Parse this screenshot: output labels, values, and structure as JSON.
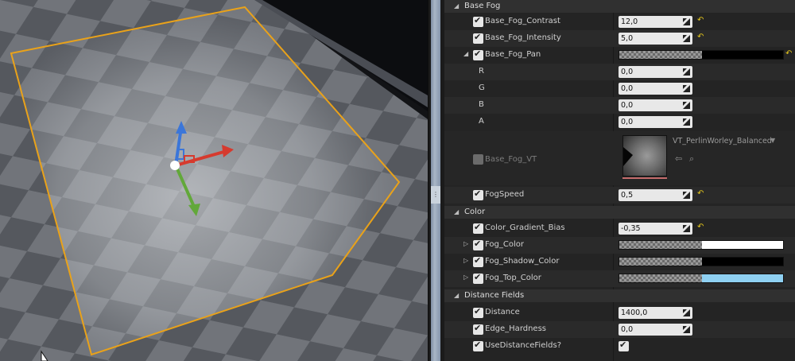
{
  "panel": {
    "categories": [
      {
        "label": "Base Fog"
      },
      {
        "label": "Color"
      },
      {
        "label": "Distance Fields"
      }
    ],
    "base_fog": {
      "contrast": {
        "label": "Base_Fog_Contrast",
        "value": "12,0"
      },
      "intensity": {
        "label": "Base_Fog_Intensity",
        "value": "5,0"
      },
      "pan": {
        "label": "Base_Fog_Pan",
        "color": "#000000",
        "r": {
          "label": "R",
          "value": "0,0"
        },
        "g": {
          "label": "G",
          "value": "0,0"
        },
        "b": {
          "label": "B",
          "value": "0,0"
        },
        "a": {
          "label": "A",
          "value": "0,0"
        }
      },
      "vt": {
        "label": "Base_Fog_VT",
        "texture": "VT_PerlinWorley_Balanced"
      },
      "speed": {
        "label": "FogSpeed",
        "value": "0,5"
      }
    },
    "color": {
      "bias": {
        "label": "Color_Gradient_Bias",
        "value": "-0,35"
      },
      "fog_color": {
        "label": "Fog_Color",
        "color": "#ffffff"
      },
      "shadow_color": {
        "label": "Fog_Shadow_Color",
        "color": "#000000"
      },
      "top_color": {
        "label": "Fog_Top_Color",
        "color": "#8fd1f2"
      }
    },
    "distance_fields": {
      "distance": {
        "label": "Distance",
        "value": "1400,0"
      },
      "hardness": {
        "label": "Edge_Hardness",
        "value": "0,0"
      },
      "use": {
        "label": "UseDistanceFields?"
      }
    }
  },
  "colors": {
    "selection_outline": "#e9a21a",
    "gizmo_x": "#d63a2e",
    "gizmo_y": "#62a83a",
    "gizmo_z": "#3b76d9",
    "reset_arrow": "#e3c51c"
  },
  "icons": [
    "checkbox-checked-icon",
    "spinner-icon",
    "reset-to-default-icon",
    "expand-arrow-icon",
    "browse-arrow-icon",
    "search-icon",
    "dropdown-icon"
  ]
}
